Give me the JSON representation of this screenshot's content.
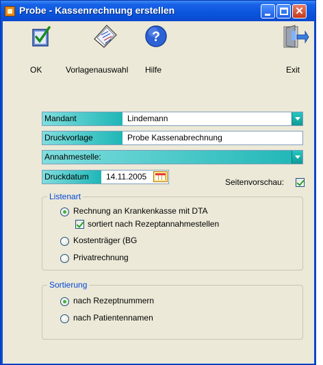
{
  "window": {
    "title": "Probe - Kassenrechnung  erstellen",
    "minimize_symbol": "",
    "maximize_symbol": "",
    "close_symbol": "✕"
  },
  "toolbar": {
    "ok_label": "OK",
    "vorlagenauswahl_label": "Vorlagenauswahl",
    "hilfe_label": "Hilfe",
    "exit_label": "Exit",
    "icons": [
      "ok-icon",
      "template-selection-icon",
      "help-icon",
      "exit-icon"
    ]
  },
  "form": {
    "mandant": {
      "label": "Mandant",
      "value": "Lindemann"
    },
    "druckvorlage": {
      "label": "Druckvorlage",
      "value": "Probe Kassenabrechnung"
    },
    "annahmestelle": {
      "label": "Annahmestelle:",
      "value": ""
    },
    "druckdatum": {
      "label": "Druckdatum",
      "value": "14.11.2005"
    },
    "seitenvorschau": {
      "label": "Seitenvorschau:",
      "checked": true
    }
  },
  "listenart": {
    "title": "Listenart",
    "options": [
      {
        "label": "Rechnung an Krankenkasse mit DTA",
        "selected": true
      },
      {
        "label": "Kostenträger (BG",
        "selected": false
      },
      {
        "label": "Privatrechnung",
        "selected": false
      }
    ],
    "sortiert": {
      "label": "sortiert nach Rezeptannahmestellen",
      "checked": true
    }
  },
  "sortierung": {
    "title": "Sortierung",
    "options": [
      {
        "label": "nach Rezeptnummern",
        "selected": true
      },
      {
        "label": "nach Patientennamen",
        "selected": false
      }
    ]
  },
  "colors": {
    "titlebar": "#0a55dc",
    "dialog_bg": "#ece9d8",
    "label_teal": "#1fb6b6",
    "group_title": "#0046d5"
  }
}
